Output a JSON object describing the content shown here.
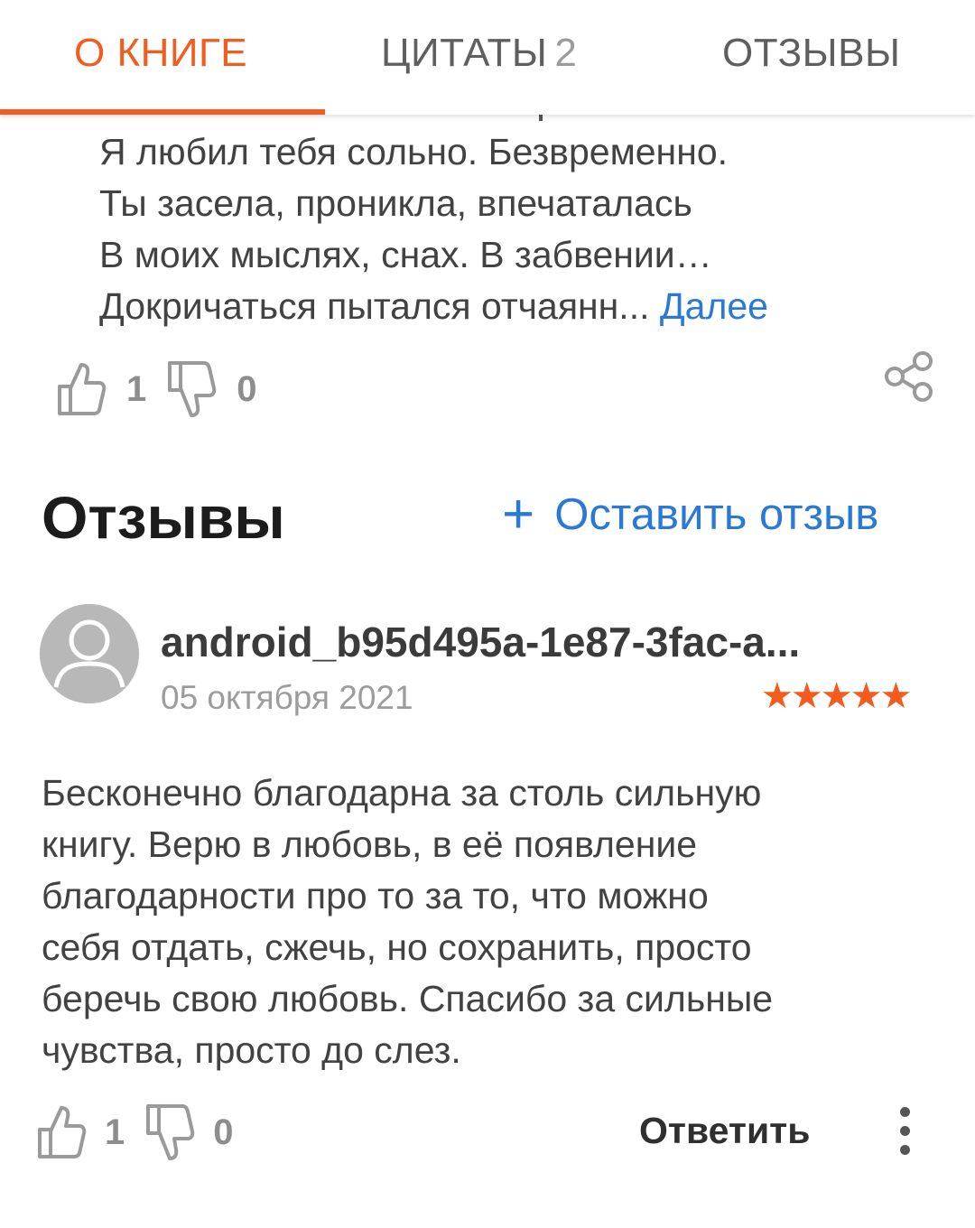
{
  "tabs": [
    {
      "label": "О КНИГЕ",
      "active": true
    },
    {
      "label": "ЦИТАТЫ",
      "count": "2",
      "active": false
    },
    {
      "label": "ОТЗЫВЫ",
      "active": false
    }
  ],
  "quote": {
    "lines": [
      "Я любил тебя сольно. Безвременно.",
      "Ты засела, проникла, впечаталась",
      "В моих мыслях, снах. В забвении…",
      "Докричаться пытался отчаянн..."
    ],
    "more_label": "Далее",
    "likes": "1",
    "dislikes": "0"
  },
  "reviews_section": {
    "title": "Отзывы",
    "leave_review_label": "Оставить отзыв"
  },
  "review": {
    "author": "android_b95d495a-1e87-3fac-a...",
    "date": "05 октября 2021",
    "rating": 5,
    "stars_text": "★★★★★",
    "text_lines": [
      "Бесконечно благодарна за столь сильную",
      "книгу. Верю в любовь, в её появление",
      "благодарности про то за то, что можно",
      "себя отдать, сжечь, но сохранить, просто",
      "беречь свою любовь. Спасибо за сильные",
      "чувства, просто до слез."
    ],
    "likes": "1",
    "dislikes": "0",
    "reply_label": "Ответить"
  },
  "colors": {
    "accent": "#f25c1f",
    "link": "#2a79d6",
    "text": "#424242"
  }
}
